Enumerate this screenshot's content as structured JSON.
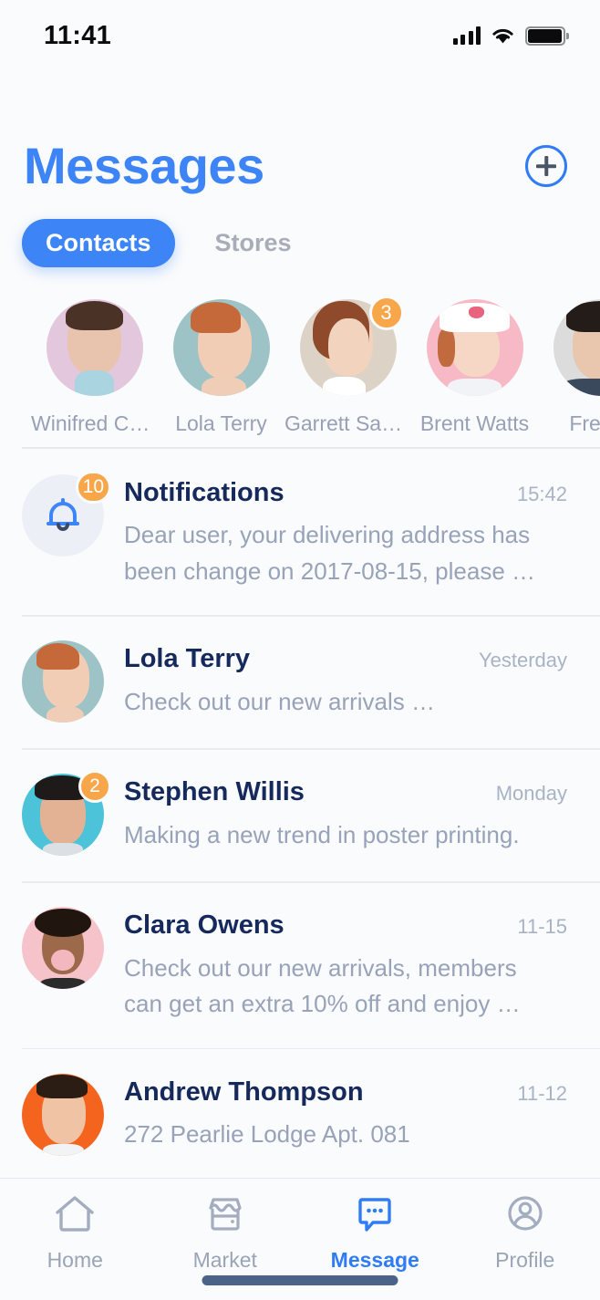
{
  "status_bar": {
    "time": "11:41",
    "icons": [
      "signal-icon",
      "wifi-icon",
      "battery-icon"
    ]
  },
  "header": {
    "title": "Messages",
    "add_button_icon": "plus-circle-icon",
    "title_color": "#3d84f7"
  },
  "tabs": [
    {
      "label": "Contacts",
      "active": true
    },
    {
      "label": "Stores",
      "active": false
    }
  ],
  "contacts": [
    {
      "name": "Winifred Co…",
      "badge": "",
      "bg": "#e3c7dd",
      "skin": "#e8c3ae",
      "hair": "#4a3226",
      "accent": "#a9d4e0"
    },
    {
      "name": "Lola Terry",
      "badge": "",
      "bg": "#9dc3c6",
      "skin": "#f0cdb4",
      "hair": "#c5693a",
      "accent": "#9dc3c6"
    },
    {
      "name": "Garrett Sau…",
      "badge": "3",
      "bg": "#ddd2c6",
      "skin": "#f2d3bd",
      "hair": "#8f4a2c",
      "accent": "#ffffff"
    },
    {
      "name": "Brent Watts",
      "badge": "",
      "bg": "#f6b9c5",
      "skin": "#f6d6c4",
      "hair": "#c06a3e",
      "accent": "#ffffff"
    },
    {
      "name": "Fred C",
      "badge": "",
      "bg": "#dcdcdc",
      "skin": "#e9c7ae",
      "hair": "#241c18",
      "accent": "#3a4a5c"
    }
  ],
  "messages": [
    {
      "type": "notification",
      "icon": "bell-icon",
      "name": "Notifications",
      "time": "15:42",
      "preview": "Dear user, your delivering address has\nbeen change on 2017-08-15, please …",
      "badge": "10"
    },
    {
      "type": "contact",
      "name": "Lola Terry",
      "time": "Yesterday",
      "preview": "Check out our new arrivals …",
      "badge": "",
      "bg": "#9dc3c6",
      "skin": "#f0cdb4",
      "hair": "#c5693a"
    },
    {
      "type": "contact",
      "name": "Stephen Willis",
      "time": "Monday",
      "preview": "Making a new trend in poster printing.",
      "badge": "2",
      "bg": "#4cc3d9",
      "skin": "#e3b294",
      "hair": "#1d1a19"
    },
    {
      "type": "contact",
      "name": "Clara Owens",
      "time": "11-15",
      "preview": "Check out our new arrivals, members\ncan get an extra 10% off and enjoy …",
      "badge": "",
      "bg": "#f6c3cb",
      "skin": "#9c6a4a",
      "hair": "#21160f"
    },
    {
      "type": "contact",
      "name": "Andrew Thompson",
      "time": "11-12",
      "preview": "272 Pearlie Lodge Apt. 081",
      "badge": "",
      "bg": "#f4641e",
      "skin": "#f0c3a5",
      "hair": "#2b1d14"
    }
  ],
  "bottom_tabs": [
    {
      "label": "Home",
      "icon": "home-icon",
      "active": false
    },
    {
      "label": "Market",
      "icon": "store-icon",
      "active": false
    },
    {
      "label": "Message",
      "icon": "chat-bubble-icon",
      "active": true
    },
    {
      "label": "Profile",
      "icon": "user-circle-icon",
      "active": false
    }
  ],
  "colors": {
    "accent": "#3d84f7",
    "badge": "#f7a64a",
    "title_dark": "#16295c",
    "muted": "#98a2b8",
    "background": "#fafbfc",
    "divider": "#e6e9f0"
  }
}
